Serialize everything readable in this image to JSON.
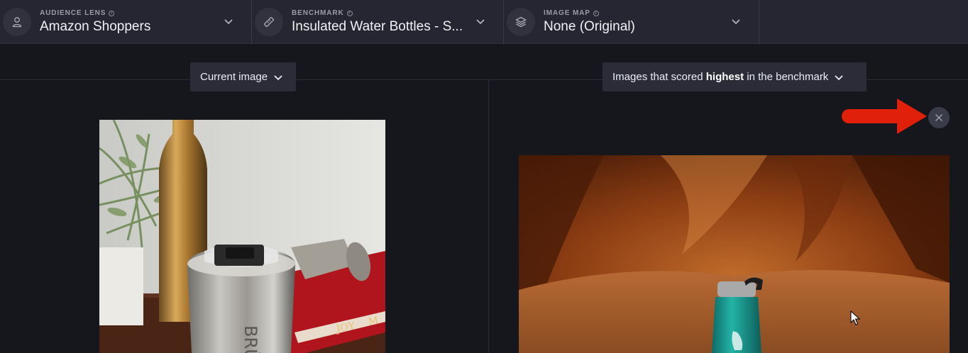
{
  "toolbar": {
    "selectors": [
      {
        "label": "AUDIENCE LENS",
        "value": "Amazon Shoppers",
        "icon": "person-icon"
      },
      {
        "label": "BENCHMARK",
        "value": "Insulated Water Bottles - S...",
        "icon": "ruler-icon"
      },
      {
        "label": "IMAGE MAP",
        "value": "None (Original)",
        "icon": "layers-icon"
      }
    ]
  },
  "comparison": {
    "left_dropdown": {
      "label": "Current image"
    },
    "right_dropdown": {
      "prefix": "Images that scored ",
      "emphasis": "highest",
      "suffix": " in the benchmark"
    }
  },
  "images": {
    "left": {
      "printed_text_a": "BRÜ",
      "printed_text_b": "JOY",
      "printed_text_c": "M"
    },
    "right": {}
  },
  "colors": {
    "background": "#16171d",
    "toolbar": "#252631",
    "dropdown": "#2b2c38",
    "annotation_arrow": "#e0200a"
  }
}
